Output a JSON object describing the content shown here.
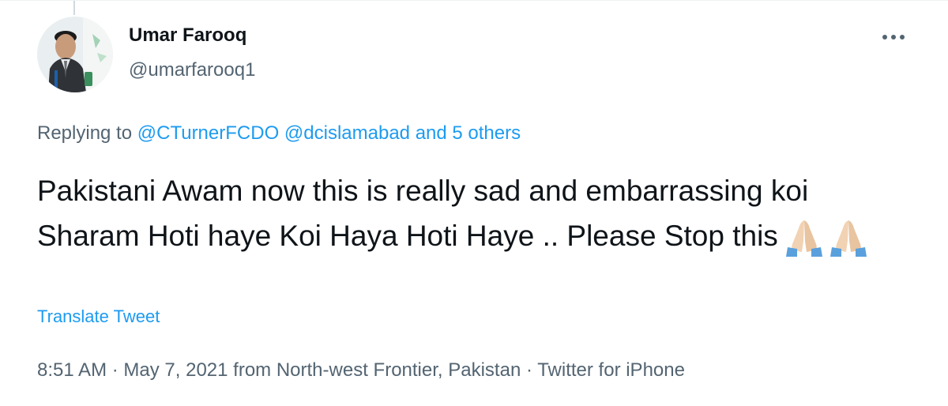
{
  "tweet": {
    "author_name": "Umar Farooq",
    "author_handle": "@umarfarooq1",
    "replying_prefix": "Replying to",
    "replying_mention_1": "@CTurnerFCDO",
    "replying_mention_2": "@dcislamabad",
    "replying_others": "and 5 others",
    "text_line": "Pakistani Awam now this is really sad and embarrassing koi Sharam Hoti haye Koi Haya Hoti Haye .. Please Stop this",
    "emojis": [
      "folded-hands-light-skin",
      "folded-hands-light-skin"
    ],
    "translate_label": "Translate Tweet",
    "time": "8:51 AM",
    "date": "May 7, 2021",
    "location_text": "from North-west Frontier, Pakistan",
    "source": "Twitter for iPhone",
    "separator": "·"
  },
  "icons": {
    "more": "more-horizontal-icon"
  },
  "colors": {
    "link": "#1d9bf0",
    "text_primary": "#0f1419",
    "text_secondary": "#536471"
  }
}
